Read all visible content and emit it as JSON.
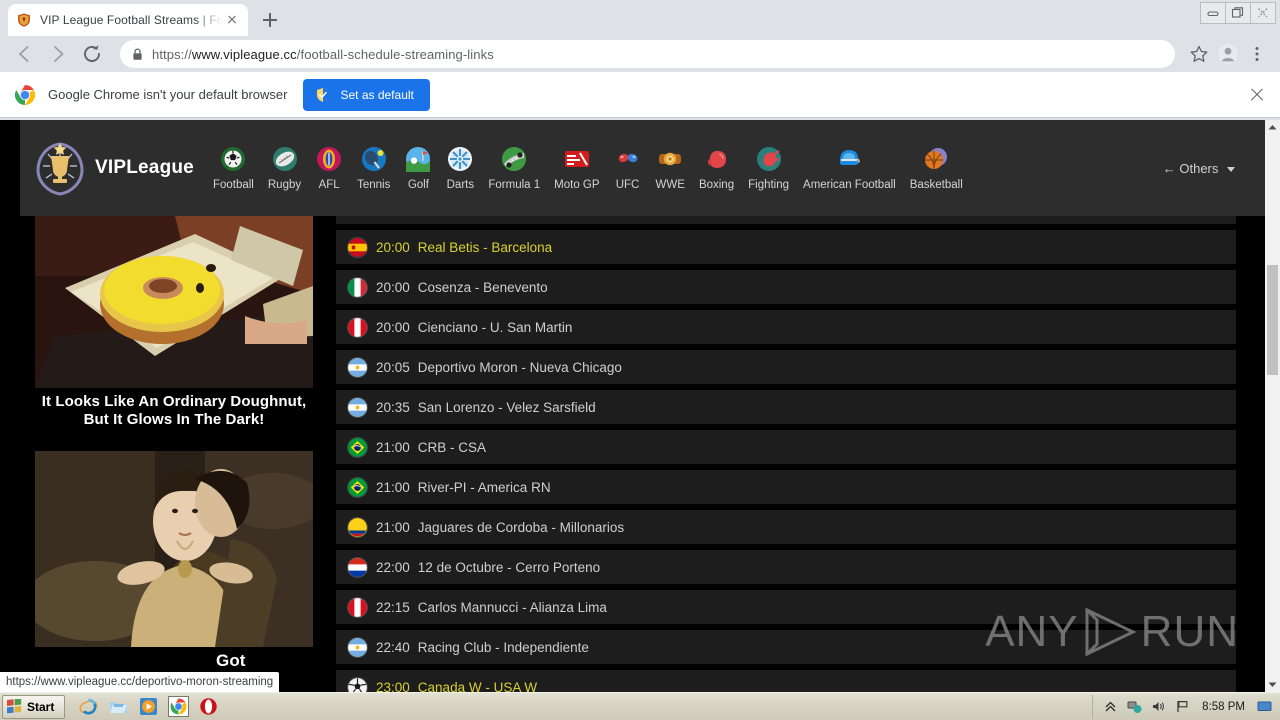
{
  "browser": {
    "tab": {
      "title": "VIP League Football Streams | Footb",
      "favicon": "shield-icon"
    },
    "newtab_label": "+",
    "window_controls": [
      "minimize-button",
      "restore-button",
      "close-button"
    ],
    "omnibox": {
      "scheme": "https://",
      "domain": "www.vipleague.cc",
      "path": "/football-schedule-streaming-links",
      "full_url": "https://www.vipleague.cc/football-schedule-streaming-links",
      "lock_icon": "lock-icon"
    },
    "nav_buttons": [
      "back-button",
      "forward-button",
      "reload-button"
    ],
    "toolbar_icons": [
      "bookmark-star-icon",
      "profile-avatar-icon",
      "chrome-menu-icon"
    ],
    "infobar": {
      "message": "Google Chrome isn't your default browser",
      "button_label": "Set as default",
      "close_label": "×"
    },
    "status_bubble": "https://www.vipleague.cc/deportivo-moron-streaming"
  },
  "site": {
    "brand": "VIPLeague",
    "nav": [
      {
        "label": "Football",
        "icon": "football-icon"
      },
      {
        "label": "Rugby",
        "icon": "rugby-icon"
      },
      {
        "label": "AFL",
        "icon": "afl-icon"
      },
      {
        "label": "Tennis",
        "icon": "tennis-icon"
      },
      {
        "label": "Golf",
        "icon": "golf-icon"
      },
      {
        "label": "Darts",
        "icon": "darts-icon"
      },
      {
        "label": "Formula 1",
        "icon": "formula1-icon"
      },
      {
        "label": "Moto GP",
        "icon": "motogp-icon"
      },
      {
        "label": "UFC",
        "icon": "ufc-icon"
      },
      {
        "label": "WWE",
        "icon": "wwe-icon"
      },
      {
        "label": "Boxing",
        "icon": "boxing-icon"
      },
      {
        "label": "Fighting",
        "icon": "fighting-icon"
      },
      {
        "label": "American Football",
        "icon": "american-football-icon"
      },
      {
        "label": "Basketball",
        "icon": "basketball-icon"
      }
    ],
    "others_label": "Others",
    "ads": [
      {
        "caption": "It Looks Like An Ordinary Doughnut, But It Glows In The Dark!",
        "image": "doughnut-photo"
      },
      {
        "caption": "Got",
        "image": "period-drama-photo"
      }
    ],
    "matches": [
      {
        "time": "20:00",
        "teams": "Real Betis - Barcelona",
        "flag": "spain-flag",
        "live": true
      },
      {
        "time": "20:00",
        "teams": "Cosenza - Benevento",
        "flag": "italy-flag",
        "live": false
      },
      {
        "time": "20:00",
        "teams": "Cienciano - U. San Martin",
        "flag": "peru-flag",
        "live": false
      },
      {
        "time": "20:05",
        "teams": "Deportivo Moron - Nueva Chicago",
        "flag": "argentina-flag",
        "live": false
      },
      {
        "time": "20:35",
        "teams": "San Lorenzo - Velez Sarsfield",
        "flag": "argentina-flag",
        "live": false
      },
      {
        "time": "21:00",
        "teams": "CRB - CSA",
        "flag": "brazil-flag",
        "live": false
      },
      {
        "time": "21:00",
        "teams": "River-PI - America RN",
        "flag": "brazil-flag",
        "live": false
      },
      {
        "time": "21:00",
        "teams": "Jaguares de Cordoba - Millonarios",
        "flag": "colombia-flag",
        "live": false
      },
      {
        "time": "22:00",
        "teams": "12 de Octubre - Cerro Porteno",
        "flag": "paraguay-flag",
        "live": false
      },
      {
        "time": "22:15",
        "teams": "Carlos Mannucci - Alianza Lima",
        "flag": "peru-flag",
        "live": false
      },
      {
        "time": "22:40",
        "teams": "Racing Club - Independiente",
        "flag": "argentina-flag",
        "live": false
      },
      {
        "time": "23:00",
        "teams": "Canada W - USA W",
        "flag": "soccer-ball",
        "live": true
      }
    ],
    "watermark": {
      "left": "ANY",
      "right": "RUN"
    }
  },
  "taskbar": {
    "start_label": "Start",
    "quick_launch": [
      "internet-explorer-icon",
      "folder-icon",
      "media-player-icon",
      "chrome-icon",
      "opera-icon"
    ],
    "tray_icons": [
      "chevron-up-icon",
      "network-icon",
      "volume-icon",
      "flag-icon"
    ],
    "clock": "8:58 PM"
  },
  "colors": {
    "accent_blue": "#1a73e8",
    "live_yellow": "#d7d12e",
    "site_header_bg": "#2d2d2d",
    "row_bg": "#1d1d1d",
    "page_bg": "#000000"
  }
}
